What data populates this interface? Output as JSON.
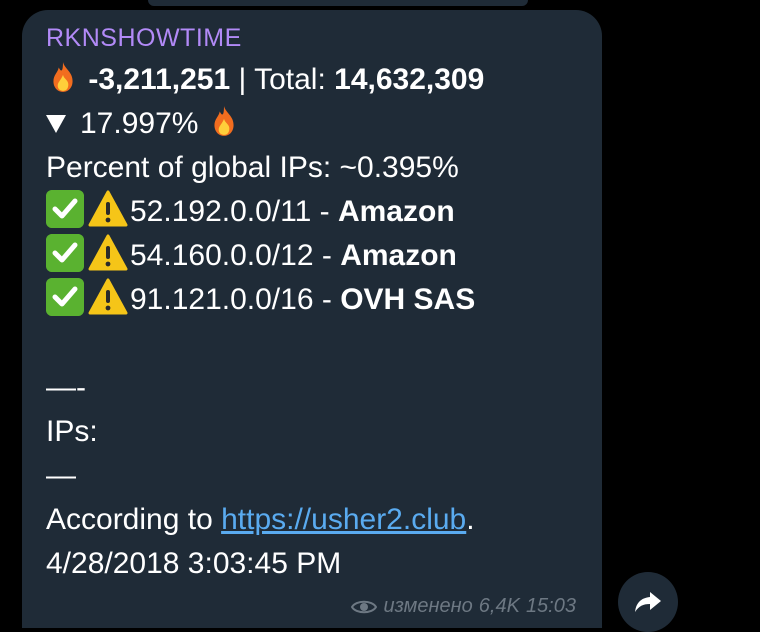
{
  "message": {
    "sender": "RKNSHOWTIME",
    "delta": "-3,211,251",
    "separator": "|",
    "total_label": "Total:",
    "total_value": "14,632,309",
    "percent_change": "17.997%",
    "global_percent_line": "Percent of global IPs: ~0.395%",
    "ranges": [
      {
        "cidr": "52.192.0.0/11",
        "dash": "-",
        "owner": "Amazon"
      },
      {
        "cidr": "54.160.0.0/12",
        "dash": "-",
        "owner": "Amazon"
      },
      {
        "cidr": "91.121.0.0/16",
        "dash": "-",
        "owner": "OVH SAS"
      }
    ],
    "divider_top": "—-",
    "ips_label": "IPs:",
    "divider_bottom": "—",
    "according_prefix": "According to ",
    "link_text": "https://usher2.club",
    "according_suffix": ".",
    "timestamp_line": "4/28/2018 3:03:45 PM",
    "meta": {
      "edited": "изменено",
      "views": "6,4K",
      "time": "15:03"
    }
  },
  "icons": {
    "fire": "fire-icon",
    "check": "check-mark-icon",
    "warning": "warning-icon",
    "eye": "eye-icon",
    "share": "share-arrow-icon"
  },
  "colors": {
    "background": "#000000",
    "bubble": "#1f2b37",
    "sender": "#b28af7",
    "link": "#5aabf0",
    "meta": "#6d7883",
    "check": "#5ab230",
    "warning": "#f5c518"
  }
}
